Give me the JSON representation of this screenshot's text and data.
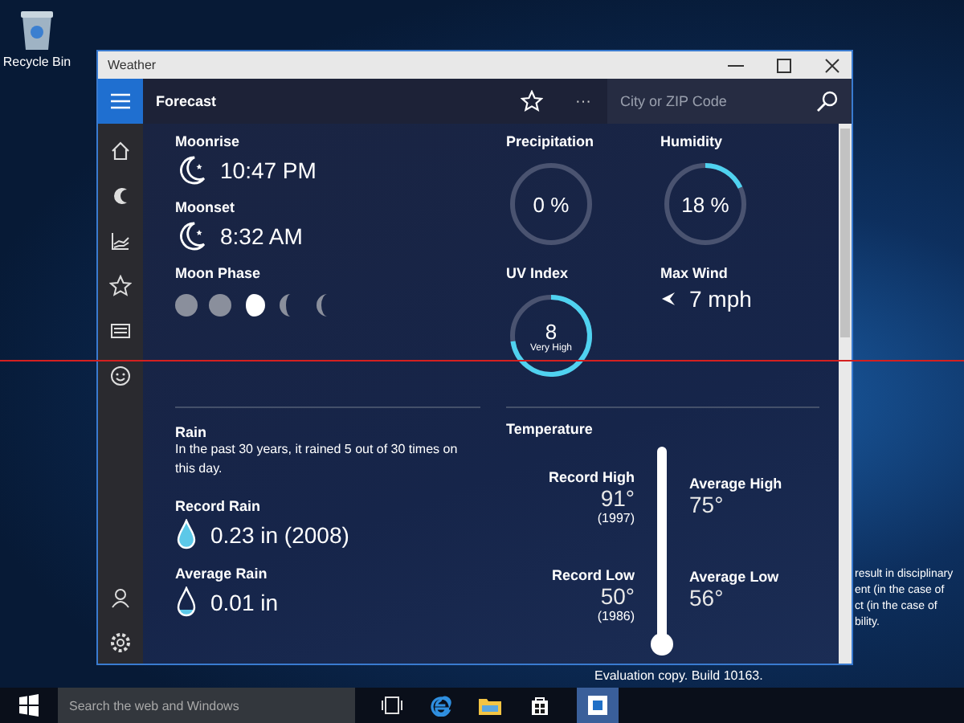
{
  "desktop": {
    "icons": [
      {
        "label": "Recycle Bin"
      }
    ],
    "background_text": [
      "result in disciplinary",
      "ent (in the case of",
      "ct (in the case of",
      "bility."
    ]
  },
  "window": {
    "title": "Weather"
  },
  "header": {
    "title": "Forecast",
    "search": {
      "placeholder": "City or ZIP Code"
    },
    "more": "···"
  },
  "moon": {
    "moonrise": {
      "label": "Moonrise",
      "value": "10:47 PM"
    },
    "moonset": {
      "label": "Moonset",
      "value": "8:32 AM"
    },
    "phase": {
      "label": "Moon Phase"
    }
  },
  "gauges": [
    {
      "label": "Precipitation",
      "value": "0 %",
      "kind": "percent"
    },
    {
      "label": "Humidity",
      "value": "18 %",
      "kind": "percent"
    },
    {
      "label": "UV Index",
      "value": "8",
      "note": "Very High",
      "kind": "uv"
    }
  ],
  "wind": {
    "label": "Max Wind",
    "value": "7 mph"
  },
  "rain": {
    "title": "Rain",
    "description": "In the past 30 years, it rained 5 out of 30 times on this day.",
    "items": [
      {
        "label": "Record Rain",
        "value": "0.23 in (2008)",
        "kind": "full"
      },
      {
        "label": "Average Rain",
        "value": "0.01 in",
        "kind": "low"
      }
    ]
  },
  "temperature": {
    "title": "Temperature",
    "record_high": {
      "label": "Record High",
      "value": "91°",
      "year": "(1997)"
    },
    "average_high": {
      "label": "Average High",
      "value": "75°"
    },
    "record_low": {
      "label": "Record Low",
      "value": "50°",
      "year": "(1986)"
    },
    "average_low": {
      "label": "Average Low",
      "value": "56°"
    }
  },
  "watermark_text": "Evaluation copy. Build 10163.",
  "taskbar": {
    "search": {
      "placeholder": "Search the web and Windows"
    }
  }
}
